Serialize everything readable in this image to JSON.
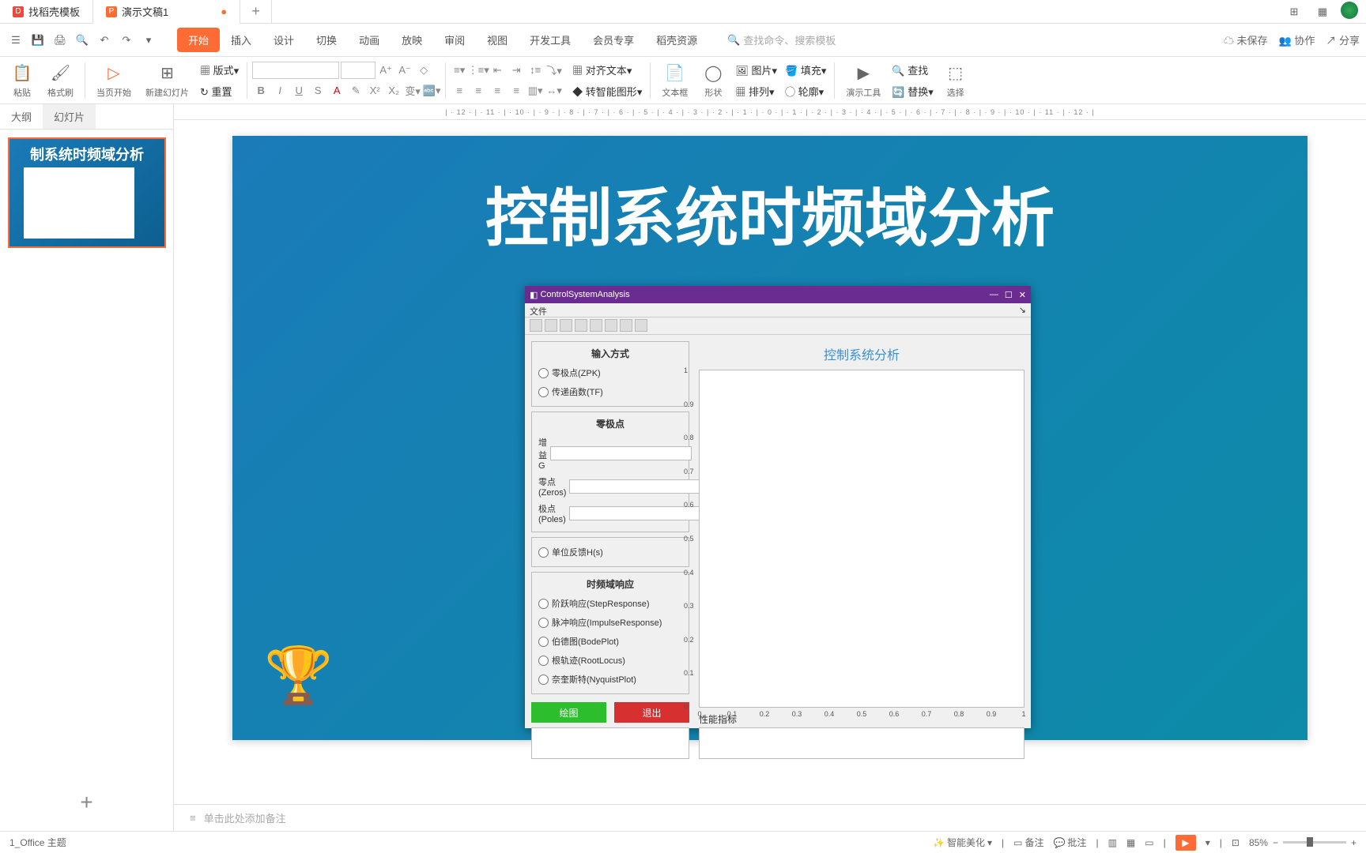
{
  "tabs": {
    "tab1": "找稻壳模板",
    "tab2": "演示文稿1",
    "modified": "●"
  },
  "ribbon_tabs": [
    "开始",
    "插入",
    "设计",
    "切换",
    "动画",
    "放映",
    "审阅",
    "视图",
    "开发工具",
    "会员专享",
    "稻壳资源"
  ],
  "search_placeholder": "查找命令、搜索模板",
  "toolbar_right": {
    "save": "未保存",
    "coop": "协作",
    "share": "分享"
  },
  "ribbon": {
    "paste": "粘贴",
    "format": "格式刷",
    "start": "当页开始",
    "newslide": "新建幻灯片",
    "layout": "版式",
    "reset": "重置",
    "font": "",
    "size": "",
    "textbox": "文本框",
    "shape": "形状",
    "image": "图片",
    "arrange": "排列",
    "outline": "轮廓",
    "fill": "填充",
    "tools": "演示工具",
    "find": "查找",
    "replace": "替换",
    "select": "选择",
    "align": "对齐文本",
    "smart": "转智能图形"
  },
  "side_tabs": {
    "outline": "大纲",
    "slides": "幻灯片"
  },
  "thumb_title": "制系统时频域分析",
  "slide": {
    "title": "控制系统时频域分析",
    "dialog": {
      "title": "ControlSystemAnalysis",
      "menu": "文件",
      "right_title": "控制系统分析",
      "input_method": "输入方式",
      "zpk": "零极点(ZPK)",
      "tf": "传递函数(TF)",
      "zp": "零极点",
      "gain": "增益G",
      "zeros": "零点(Zeros)",
      "poles": "极点(Poles)",
      "unit": "单位反馈H(s)",
      "response": "时频域响应",
      "step": "阶跃响应(StepResponse)",
      "impulse": "脉冲响应(ImpulseResponse)",
      "bode": "伯德图(BodePlot)",
      "root": "根轨迹(RootLocus)",
      "nyq": "奈奎斯特(NyquistPlot)",
      "draw": "绘图",
      "exit": "退出",
      "perf": "性能指标"
    }
  },
  "notes_placeholder": "单击此处添加备注",
  "status": {
    "theme": "1_Office 主题",
    "beautify": "智能美化",
    "notes": "备注",
    "comments": "批注",
    "zoom": "85%"
  },
  "chart_data": {
    "type": "line",
    "title": "",
    "x": [
      0,
      0.1,
      0.2,
      0.3,
      0.4,
      0.5,
      0.6,
      0.7,
      0.8,
      0.9,
      1
    ],
    "y_ticks": [
      0,
      0.1,
      0.2,
      0.3,
      0.4,
      0.5,
      0.6,
      0.7,
      0.8,
      0.9,
      1
    ],
    "series": [],
    "xlim": [
      0,
      1
    ],
    "ylim": [
      0,
      1
    ]
  },
  "ruler_text": "| · 12 · | · 11 · | · 10 · | · 9 · | · 8 · | · 7 · | · 6 · | · 5 · | · 4 · | · 3 · | · 2 · | · 1 · | · 0 · | · 1 · | · 2 · | · 3 · | · 4 · | · 5 · | · 6 · | · 7 · | · 8 · | · 9 · | · 10 · | · 11 · | · 12 · |"
}
